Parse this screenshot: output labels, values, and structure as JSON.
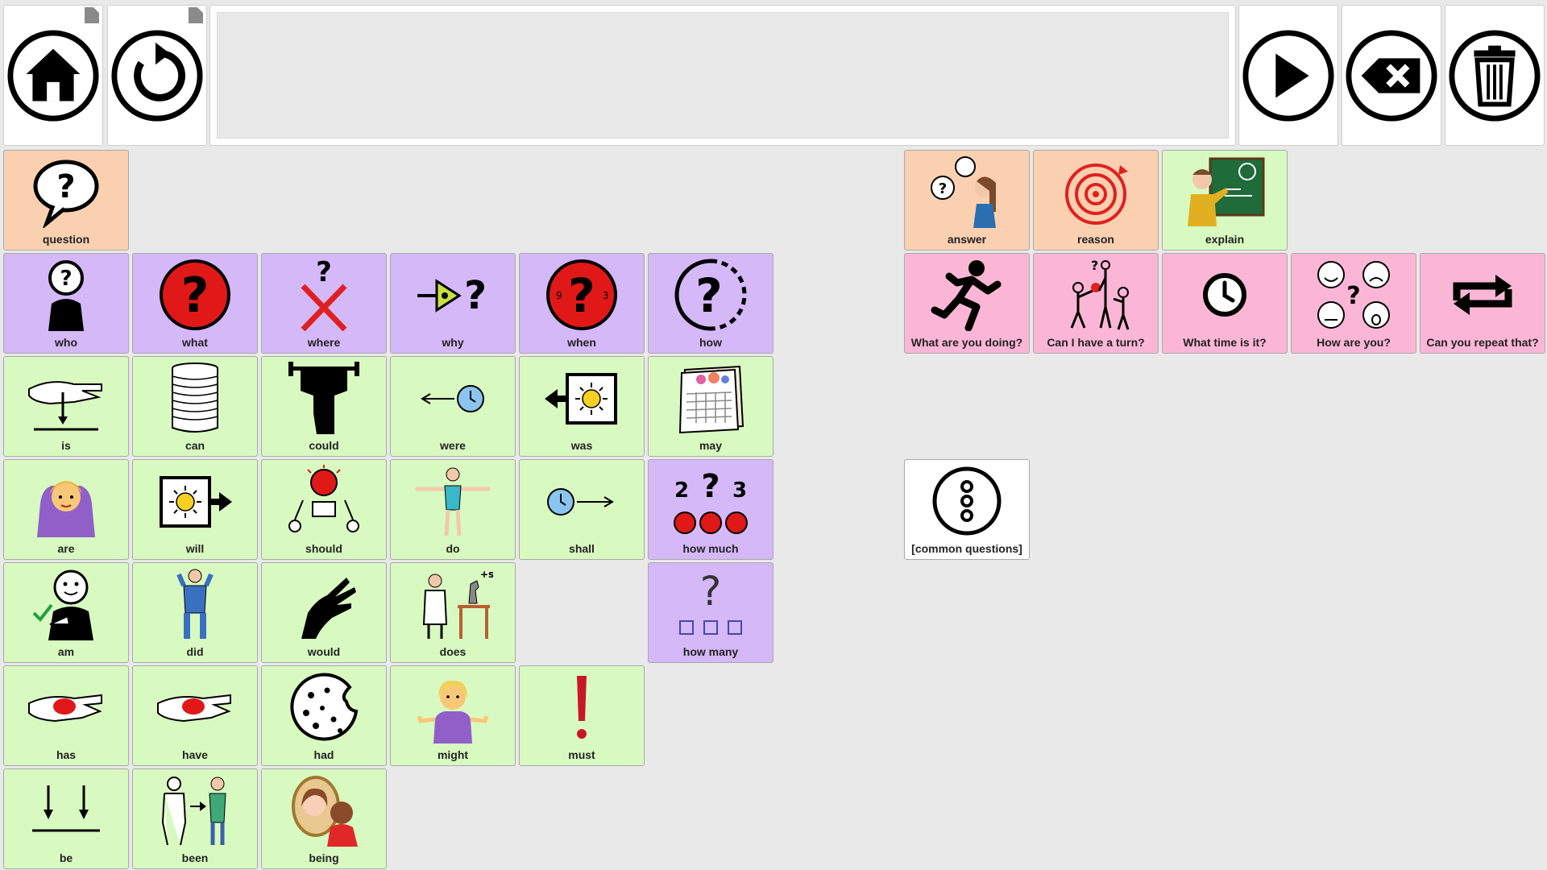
{
  "toolbar": {
    "home_icon": "home-icon",
    "back_icon": "undo-icon",
    "speak_icon": "play-icon",
    "backspace_icon": "backspace-icon",
    "clear_icon": "trash-icon"
  },
  "message_bar": {
    "text": ""
  },
  "colors": {
    "question": "#fbd0b0",
    "wh_word": "#d4b8f8",
    "verb": "#d8fac0",
    "phrase": "#fbb6d6",
    "folder": "#ffffff"
  },
  "cells": {
    "question": "question",
    "who": "who",
    "what": "what",
    "where": "where",
    "why": "why",
    "when": "when",
    "how": "how",
    "is": "is",
    "can": "can",
    "could": "could",
    "were": "were",
    "was": "was",
    "may": "may",
    "are": "are",
    "will": "will",
    "should": "should",
    "do": "do",
    "shall": "shall",
    "how_much": "how much",
    "am": "am",
    "did": "did",
    "would": "would",
    "does": "does",
    "how_many": "how many",
    "has": "has",
    "have": "have",
    "had": "had",
    "might": "might",
    "must": "must",
    "be": "be",
    "been": "been",
    "being": "being",
    "answer": "answer",
    "reason": "reason",
    "explain": "explain",
    "what_doing": "What are you doing?",
    "have_turn": "Can I have a turn?",
    "what_time": "What time is it?",
    "how_are_you": "How are you?",
    "repeat": "Can you repeat that?",
    "common_questions": "[common questions]"
  }
}
